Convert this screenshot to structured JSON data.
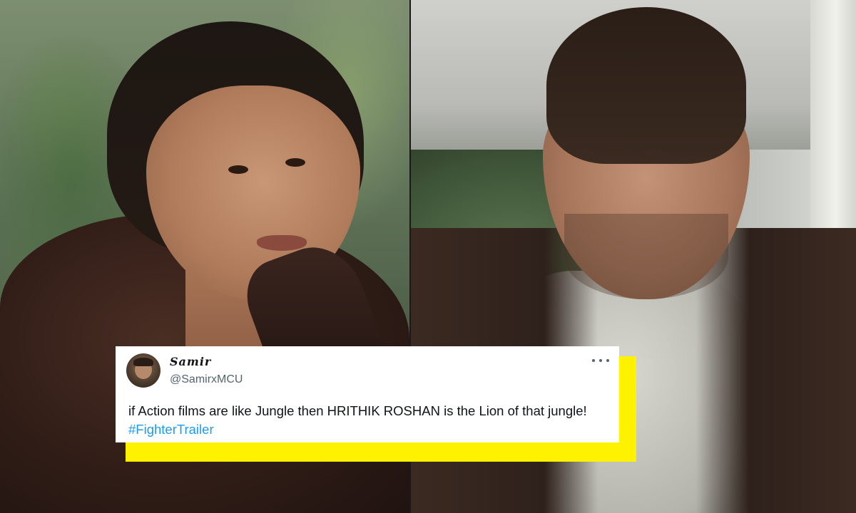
{
  "tweet": {
    "display_name": "Samir",
    "handle": "@SamirxMCU",
    "text": "if Action films are like Jungle then HRITHIK ROSHAN is the Lion of that jungle!",
    "hashtag": "#FighterTrailer",
    "more_icon": "more-horizontal-icon"
  },
  "colors": {
    "accent_yellow": "#fff200",
    "hashtag_blue": "#1d9bf0",
    "text_primary": "#0f1419",
    "text_secondary": "#536471"
  }
}
